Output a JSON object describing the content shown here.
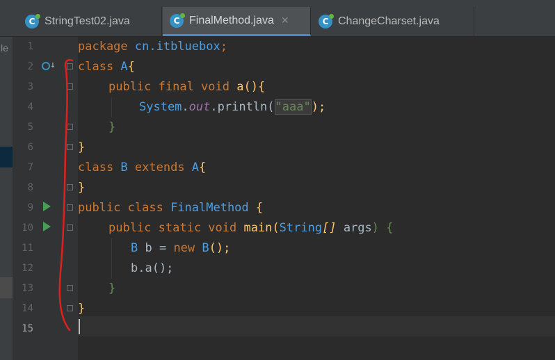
{
  "tabs": [
    {
      "label": "StringTest02.java",
      "active": false
    },
    {
      "label": "FinalMethod.java",
      "active": true
    },
    {
      "label": "ChangeCharset.java",
      "active": false
    }
  ],
  "colors": {
    "keyword": "#cc7832",
    "class": "#4a9fe6",
    "method": "#ffc66d",
    "string": "#6a8759",
    "field": "#9876aa",
    "text": "#a9b7c6",
    "annotation_stroke": "#e0201e"
  },
  "icons": {
    "file": "java-class-icon",
    "close": "close-icon",
    "run": "run-icon",
    "override": "override-icon",
    "fold": "fold-icon"
  },
  "line_numbers": [
    "1",
    "2",
    "3",
    "4",
    "5",
    "6",
    "7",
    "8",
    "9",
    "10",
    "11",
    "12",
    "13",
    "14",
    "15"
  ],
  "current_line": "15",
  "left_panel_text": "le",
  "code": {
    "l1": {
      "a": "package ",
      "b": "cn.itbluebox",
      "c": ";"
    },
    "l2": {
      "a": "class ",
      "b": "A",
      "c": "{"
    },
    "l3": {
      "a": "public final void ",
      "b": "a",
      "c": "(){"
    },
    "l4": {
      "a": "System",
      "b": ".",
      "c": "out",
      "d": ".println(",
      "e": "\"aaa\"",
      "f": ");"
    },
    "l5": {
      "a": "}"
    },
    "l6": {
      "a": "}"
    },
    "l7": {
      "a": "class ",
      "b": "B",
      "c": " extends ",
      "d": "A",
      "e": "{"
    },
    "l8": {
      "a": "}"
    },
    "l9": {
      "a": "public class ",
      "b": "FinalMethod",
      "c": " {"
    },
    "l10": {
      "a": "public static void ",
      "b": "main",
      "c": "(",
      "d": "String",
      "e": "[]",
      "f": " args",
      "g": ") {"
    },
    "l11": {
      "a": "B",
      "b": " b = ",
      "c": "new ",
      "d": "B",
      "e": "();"
    },
    "l12": {
      "a": "b.a();"
    },
    "l13": {
      "a": "}"
    },
    "l14": {
      "a": "}"
    }
  }
}
